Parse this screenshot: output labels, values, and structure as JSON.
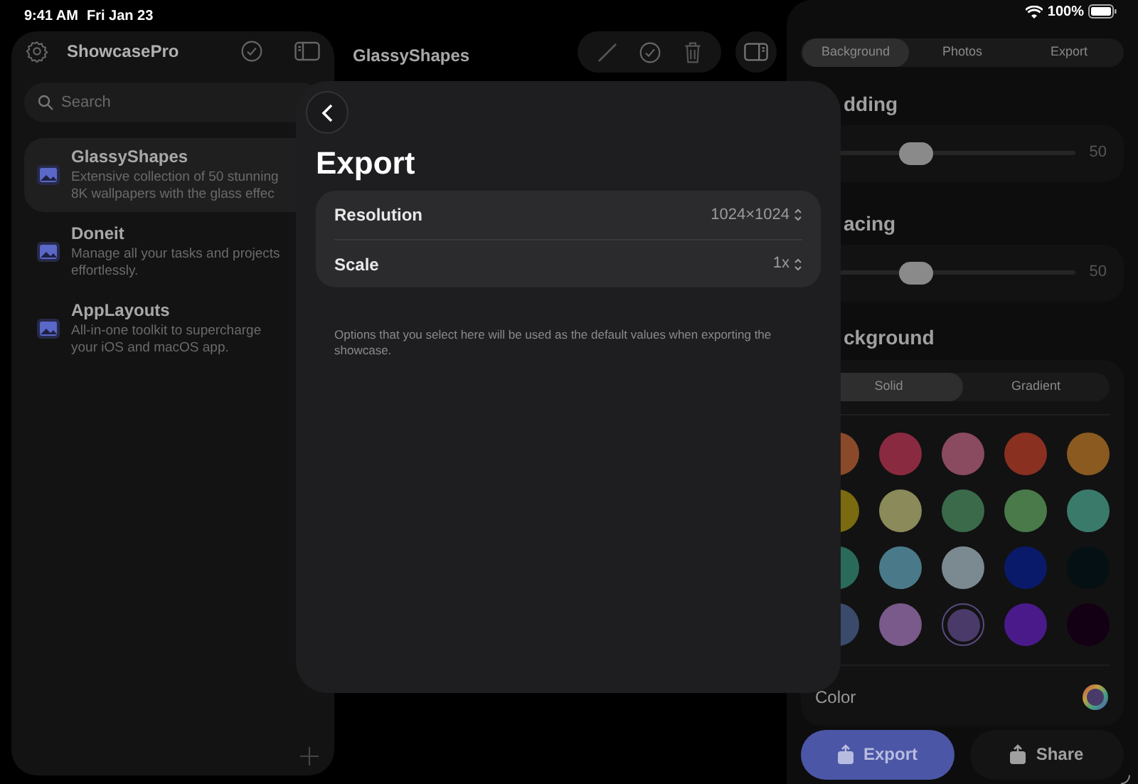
{
  "status_bar": {
    "time": "9:41 AM",
    "date": "Fri Jan 23",
    "battery": "100%"
  },
  "sidebar": {
    "title": "ShowcasePro",
    "search": {
      "placeholder": "Search"
    },
    "items": [
      {
        "title": "GlassyShapes",
        "description": "Extensive collection of 50 stunning 8K wallpapers with the glass effec",
        "selected": true
      },
      {
        "title": "Doneit",
        "description": "Manage all your tasks and projects effortlessly.",
        "selected": false
      },
      {
        "title": "AppLayouts",
        "description": "All-in-one toolkit to supercharge your iOS and macOS app.",
        "selected": false
      }
    ]
  },
  "detail": {
    "title": "GlassyShapes"
  },
  "inspector": {
    "tabs": [
      {
        "label": "Background",
        "selected": true
      },
      {
        "label": "Photos",
        "selected": false
      },
      {
        "label": "Export",
        "selected": false
      }
    ],
    "sliders": [
      {
        "heading": "dding",
        "level": 0.38,
        "reading": "50"
      },
      {
        "heading": "acing",
        "level": 0.38,
        "reading": "50"
      }
    ],
    "background": {
      "heading": "ckground",
      "modes": [
        {
          "label": "Solid",
          "selected": true
        },
        {
          "label": "Gradient",
          "selected": false
        }
      ],
      "swatches": [
        {
          "color": "#8a4a2a",
          "selected": false
        },
        {
          "color": "#8a2a40",
          "selected": false
        },
        {
          "color": "#8a4a60",
          "selected": false
        },
        {
          "color": "#8a3020",
          "selected": false
        },
        {
          "color": "#8a5a20",
          "selected": false
        },
        {
          "color": "#7a6a10",
          "selected": false
        },
        {
          "color": "#8a8a5a",
          "selected": false
        },
        {
          "color": "#3a6a4a",
          "selected": false
        },
        {
          "color": "#4a7a4a",
          "selected": false
        },
        {
          "color": "#3a7a6a",
          "selected": false
        },
        {
          "color": "#2a6a5a",
          "selected": false
        },
        {
          "color": "#4a7a8a",
          "selected": false
        },
        {
          "color": "#7a8a90",
          "selected": false
        },
        {
          "color": "#0a1a6a",
          "selected": false
        },
        {
          "color": "#041014",
          "selected": false
        },
        {
          "color": "#3a4a6a",
          "selected": false
        },
        {
          "color": "#7a5a8a",
          "selected": false
        },
        {
          "color": "#4a3a6a",
          "selected": true
        },
        {
          "color": "#4a1a8a",
          "selected": false
        },
        {
          "color": "#140014",
          "selected": false
        }
      ],
      "color_label": "Color"
    },
    "buttons": [
      {
        "label": "Export",
        "kind": "primary"
      },
      {
        "label": "Share",
        "kind": "secondary"
      }
    ]
  },
  "export_sheet": {
    "title": "Export",
    "rows": [
      {
        "label": "Resolution",
        "value": "1024×1024"
      },
      {
        "label": "Scale",
        "value": "1x"
      }
    ],
    "note": "Options that you select here will be used as the default values when exporting the showcase."
  }
}
